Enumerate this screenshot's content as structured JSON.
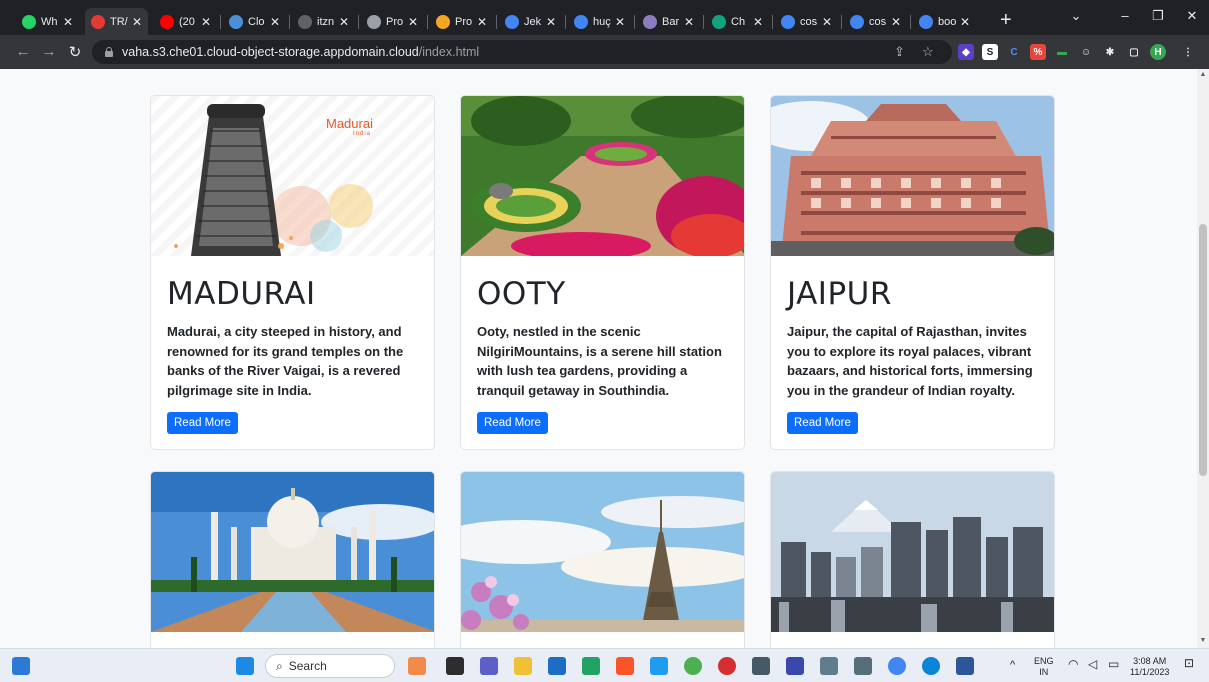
{
  "browser": {
    "tabs": [
      {
        "label": "Wh",
        "color": "#25d366"
      },
      {
        "label": "TR/",
        "color": "#e53935",
        "active": true
      },
      {
        "label": "(20",
        "color": "#ff0000"
      },
      {
        "label": "Clo",
        "color": "#4a90d9"
      },
      {
        "label": "itzn",
        "color": "#5f6368"
      },
      {
        "label": "Pro",
        "color": "#9aa0a6"
      },
      {
        "label": "Pro",
        "color": "#f5a623"
      },
      {
        "label": "Jek",
        "color": "#4285f4"
      },
      {
        "label": "huç",
        "color": "#4285f4"
      },
      {
        "label": "Bar",
        "color": "#8e7cc3"
      },
      {
        "label": "Ch",
        "color": "#10a37f"
      },
      {
        "label": "cos",
        "color": "#4285f4"
      },
      {
        "label": "cos",
        "color": "#4285f4"
      },
      {
        "label": "boo",
        "color": "#4285f4"
      }
    ],
    "url_host": "vaha.s3.che01.cloud-object-storage.appdomain.cloud",
    "url_path": "/index.html",
    "profile_initial": "H"
  },
  "cards": [
    {
      "title": "MADURAI",
      "image_caption": "Madurai",
      "image_subcaption": "India",
      "text": "Madurai, a city steeped in history, and renowned for its grand temples on the banks of the River Vaigai, is a revered pilgrimage site in India.",
      "button": "Read More"
    },
    {
      "title": "OOTY",
      "text": "Ooty, nestled in the scenic NilgiriMountains, is a serene hill station with lush tea gardens, providing a tranquil getaway in Southindia.",
      "button": "Read More"
    },
    {
      "title": "JAIPUR",
      "text": "Jaipur, the capital of Rajasthan, invites you to explore its royal palaces, vibrant bazaars, and historical forts, immersing you in the grandeur of Indian royalty.",
      "button": "Read More"
    }
  ],
  "taskbar": {
    "search_placeholder": "Search",
    "lang_top": "ENG",
    "lang_bottom": "IN",
    "time": "3:08 AM",
    "date": "11/1/2023"
  }
}
